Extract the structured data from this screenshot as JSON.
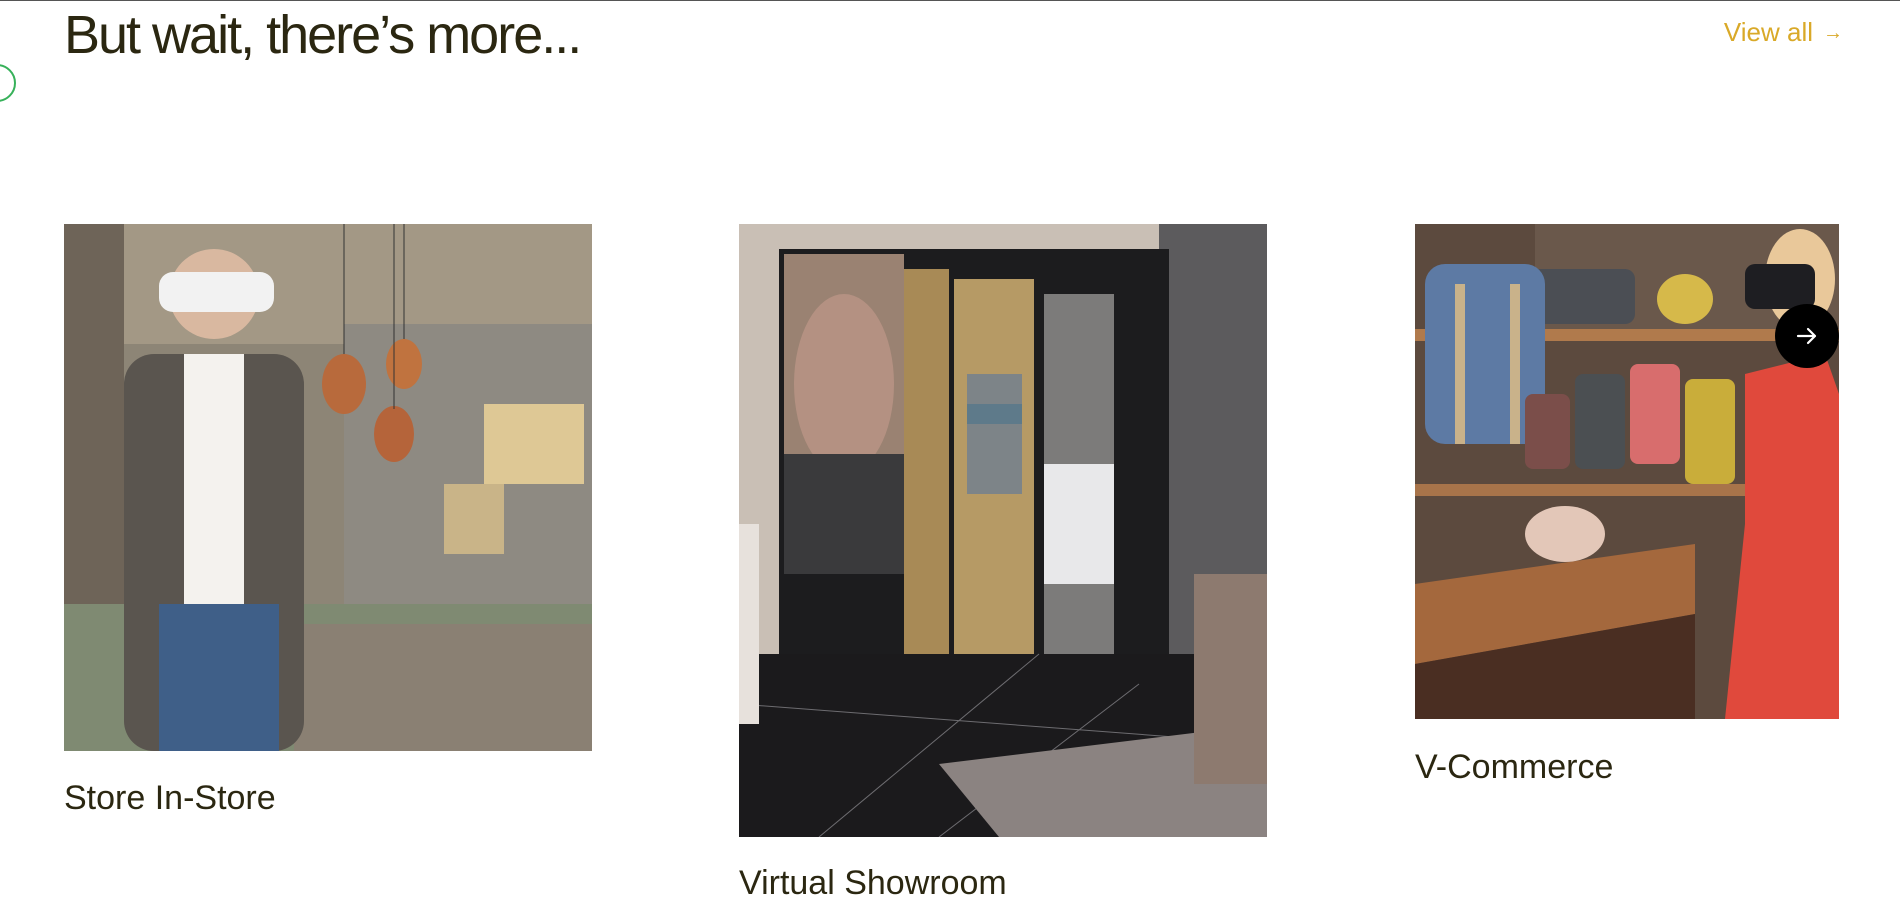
{
  "section": {
    "title": "But wait, there’s more...",
    "view_all_label": "View all",
    "view_all_icon": "arrow-right-icon",
    "accent_color": "#d9a928"
  },
  "cards": [
    {
      "label": "Store In-Store",
      "image": "man-in-vr-headset-in-living-room"
    },
    {
      "label": "Virtual Showroom",
      "image": "marble-showroom-with-hanging-sweater"
    },
    {
      "label": "V-Commerce",
      "image": "woman-in-vr-headset-with-backpacks-on-shelves"
    }
  ],
  "carousel": {
    "next_icon": "arrow-right-icon"
  }
}
